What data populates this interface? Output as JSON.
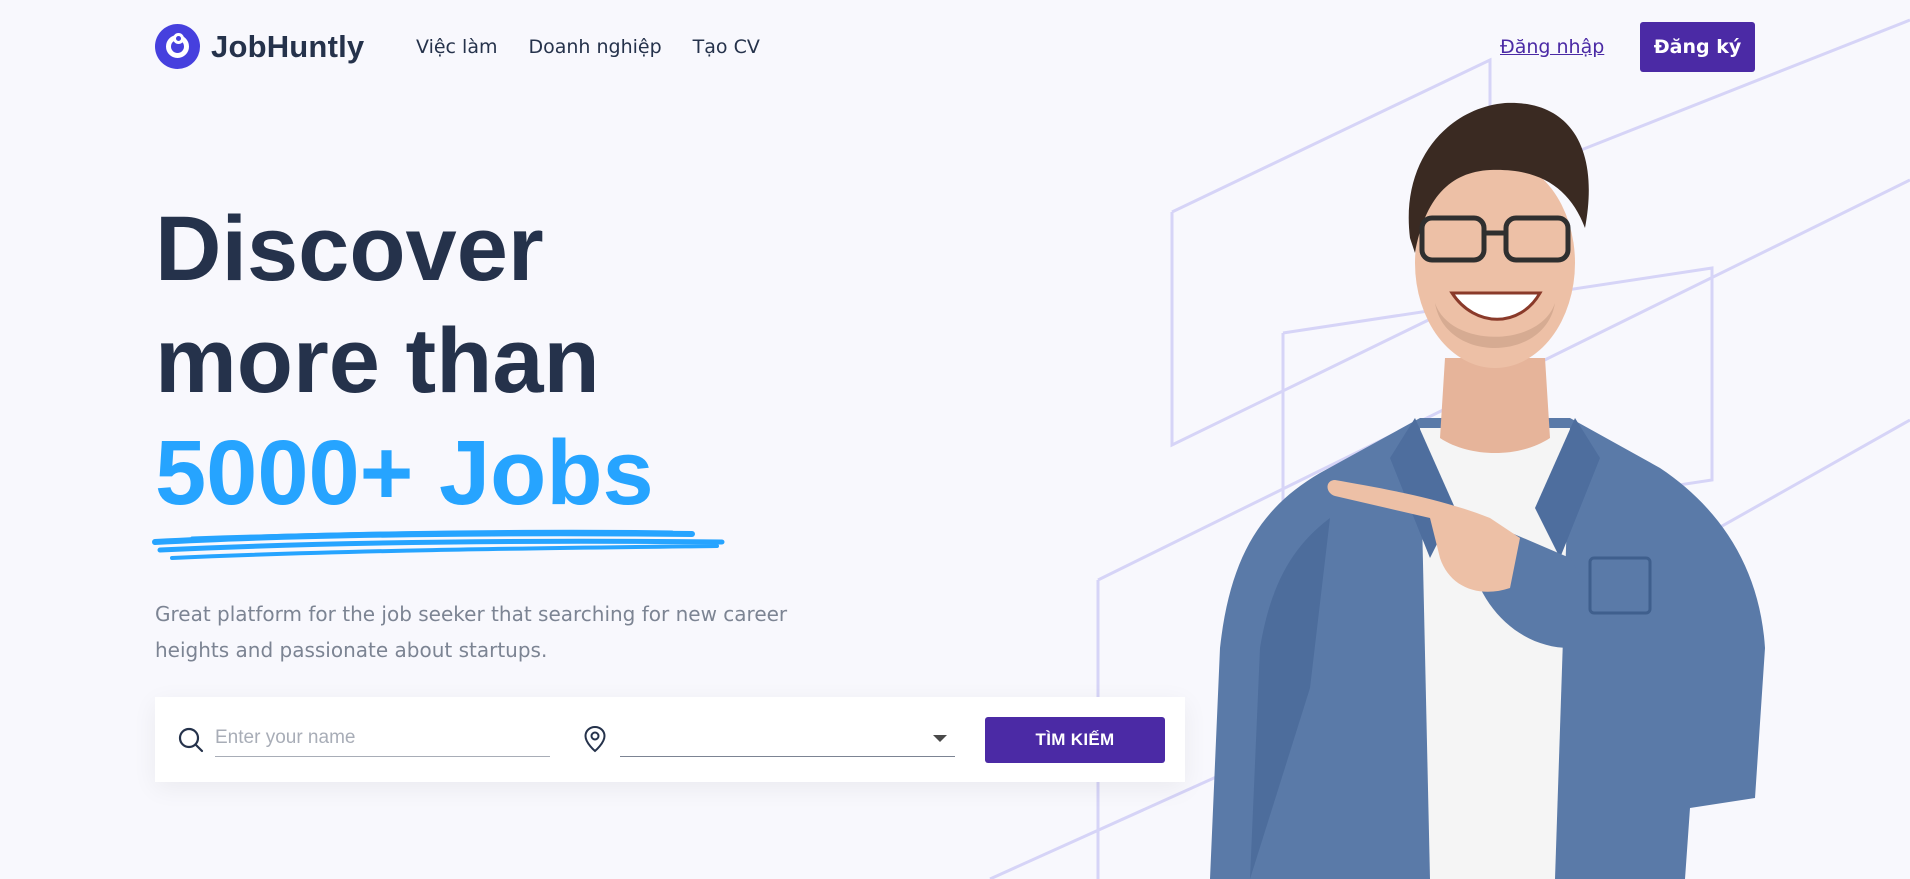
{
  "brand": {
    "name": "JobHuntly",
    "primary": "#4b2aa5",
    "accent": "#26a4ff"
  },
  "nav": {
    "items": [
      "Việc làm",
      "Doanh nghiệp",
      "Tạo CV"
    ]
  },
  "auth": {
    "login": "Đăng nhập",
    "register": "Đăng ký"
  },
  "hero": {
    "line1": "Discover",
    "line2": "more than",
    "line3": "5000+ Jobs",
    "subtitle": "Great platform for the job seeker that searching for new career heights and passionate about startups."
  },
  "search": {
    "name_placeholder": "Enter your name",
    "name_value": "",
    "location_value": "",
    "button": "TÌM KIẾM",
    "icons": {
      "name": "search-icon",
      "location": "map-pin-icon",
      "dropdown": "caret-down-icon"
    }
  },
  "image": {
    "subject": "hero-person-photo"
  }
}
